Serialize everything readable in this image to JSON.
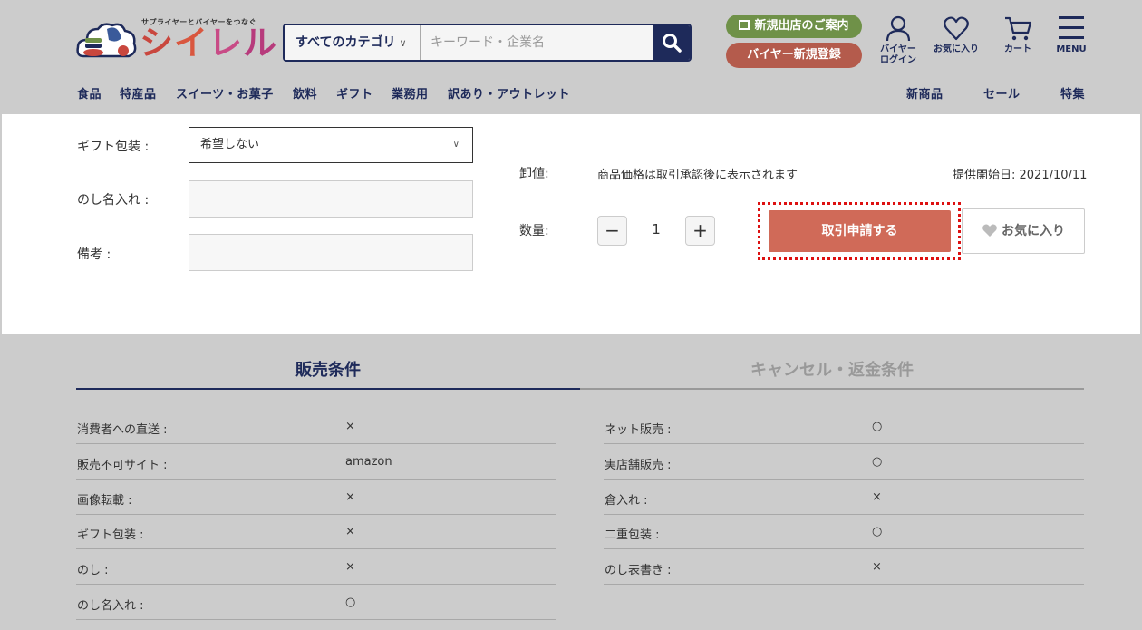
{
  "header": {
    "logo_tagline": "サプライヤーとバイヤーをつなぐ",
    "logo_text": [
      "シ",
      "イ",
      "レ",
      "ル"
    ],
    "search": {
      "category_label": "すべてのカテゴリ",
      "placeholder": "キーワード・企業名"
    },
    "shop_button": "新規出店のご案内",
    "register_button": "バイヤー新規登録",
    "icons": [
      {
        "label": "バイヤー ログイン",
        "icon": "user-icon"
      },
      {
        "label": "お気に入り",
        "icon": "heart-icon"
      },
      {
        "label": "カート",
        "icon": "cart-icon"
      },
      {
        "label": "MENU",
        "icon": "hamburger-icon"
      }
    ]
  },
  "nav": {
    "left": [
      "食品",
      "特産品",
      "スイーツ・お菓子",
      "飲料",
      "ギフト",
      "業務用",
      "訳あり・アウトレット"
    ],
    "right": [
      "新商品",
      "セール",
      "特集"
    ]
  },
  "form": {
    "gift_label": "ギフト包装 :",
    "gift_value": "希望しない",
    "noshi_label": "のし名入れ :",
    "note_label": "備考 :"
  },
  "product": {
    "price_label": "卸値:",
    "price_value": "商品価格は取引承認後に表示されます",
    "start_date": "提供開始日: 2021/10/11",
    "qty_label": "数量:",
    "minus": "−",
    "qty": "1",
    "plus": "+",
    "trade_button": "取引申請する",
    "fav_button": "お気に入り"
  },
  "tabs": {
    "active": "販売条件",
    "inactive": "キャンセル・返金条件"
  },
  "conditions": {
    "left": [
      {
        "k": "消費者への直送 :",
        "v": "×"
      },
      {
        "k": "販売不可サイト :",
        "v": "amazon"
      },
      {
        "k": "画像転載 :",
        "v": "×"
      },
      {
        "k": "ギフト包装 :",
        "v": "×"
      },
      {
        "k": "のし :",
        "v": "×"
      },
      {
        "k": "のし名入れ :",
        "v": "○"
      }
    ],
    "right": [
      {
        "k": "ネット販売 :",
        "v": "○"
      },
      {
        "k": "実店舗販売 :",
        "v": "○"
      },
      {
        "k": "倉入れ :",
        "v": "×"
      },
      {
        "k": "二重包装 :",
        "v": "○"
      },
      {
        "k": "のし表書き :",
        "v": "×"
      }
    ]
  },
  "colors": {
    "navy": "#1e2a5a",
    "green": "#6f9148",
    "red_button": "#d06a58",
    "highlight": "#dd1111"
  }
}
